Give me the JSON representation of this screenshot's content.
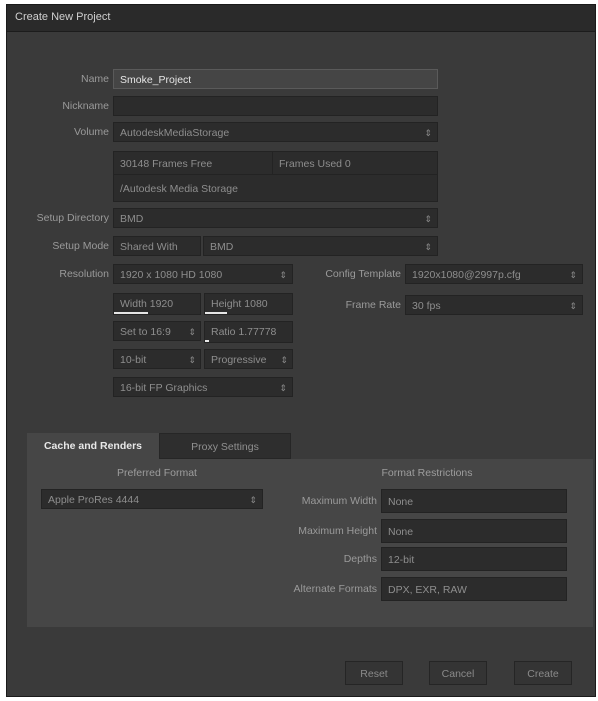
{
  "window": {
    "title": "Create New Project"
  },
  "project": {
    "name_label": "Name",
    "name_value": "Smoke_Project",
    "nickname_label": "Nickname",
    "nickname_value": "",
    "volume_label": "Volume",
    "volume_value": "AutodeskMediaStorage",
    "frames_free": "30148 Frames Free",
    "frames_used": "Frames Used 0",
    "storage_path": "/Autodesk Media Storage",
    "setup_dir_label": "Setup Directory",
    "setup_dir_value": "BMD",
    "setup_mode_label": "Setup Mode",
    "setup_mode_value": "Shared With",
    "setup_mode_target": "BMD"
  },
  "resolution": {
    "label": "Resolution",
    "value": "1920 x 1080 HD 1080",
    "width": "Width 1920",
    "height": "Height 1080",
    "aspect_preset": "Set to 16:9",
    "ratio": "Ratio 1.77778",
    "bit_depth": "10-bit",
    "scan_mode": "Progressive",
    "graphics": "16-bit FP Graphics",
    "config_label": "Config Template",
    "config_value": "1920x1080@2997p.cfg",
    "frame_rate_label": "Frame Rate",
    "frame_rate_value": "30 fps"
  },
  "tabs": [
    {
      "label": "Cache and Renders"
    },
    {
      "label": "Proxy Settings"
    }
  ],
  "cache": {
    "preferred_heading": "Preferred Format",
    "preferred_value": "Apple ProRes 4444",
    "restrictions_heading": "Format Restrictions",
    "max_width_label": "Maximum Width",
    "max_width_value": "None",
    "max_height_label": "Maximum Height",
    "max_height_value": "None",
    "depths_label": "Depths",
    "depths_value": "12-bit",
    "alt_formats_label": "Alternate Formats",
    "alt_formats_value": "DPX, EXR, RAW"
  },
  "buttons": {
    "reset": "Reset",
    "cancel": "Cancel",
    "create": "Create"
  },
  "colors": {
    "window_bg": "#3a3a3a",
    "field_bg": "#2c2c2c",
    "active_field": "#454545",
    "titlebar": "#2a2a2a"
  }
}
